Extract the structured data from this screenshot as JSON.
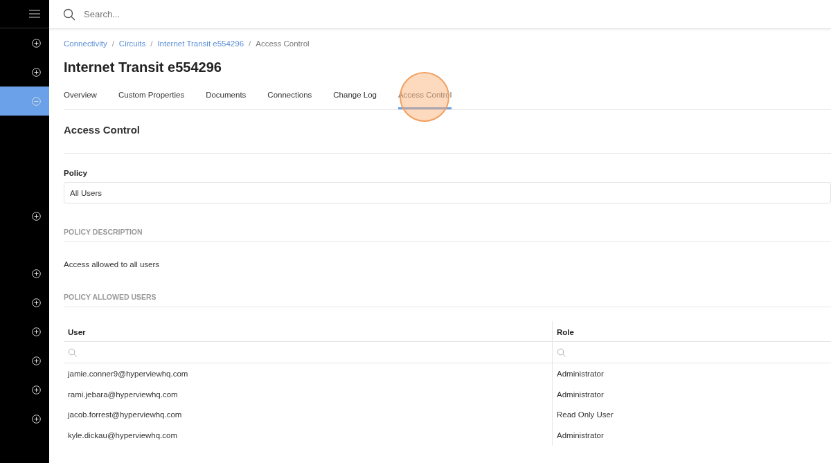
{
  "sidebar": {
    "groups": [
      {
        "items": [
          {
            "expanded": false,
            "selected": false
          },
          {
            "expanded": false,
            "selected": false
          },
          {
            "expanded": true,
            "selected": true
          }
        ]
      },
      {
        "items": [
          {
            "expanded": false,
            "selected": false
          }
        ]
      },
      {
        "items": [
          {
            "expanded": false,
            "selected": false
          },
          {
            "expanded": false,
            "selected": false
          },
          {
            "expanded": false,
            "selected": false
          },
          {
            "expanded": false,
            "selected": false
          },
          {
            "expanded": false,
            "selected": false
          },
          {
            "expanded": false,
            "selected": false
          }
        ]
      }
    ]
  },
  "search": {
    "placeholder": "Search..."
  },
  "breadcrumbs": [
    {
      "label": "Connectivity",
      "link": true
    },
    {
      "label": "Circuits",
      "link": true
    },
    {
      "label": "Internet Transit e554296",
      "link": true
    },
    {
      "label": "Access Control",
      "link": false
    }
  ],
  "breadcrumb_separator": "/",
  "title": "Internet Transit e554296",
  "tabs": [
    {
      "label": "Overview",
      "selected": false,
      "highlighted": false
    },
    {
      "label": "Custom Properties",
      "selected": false,
      "highlighted": false
    },
    {
      "label": "Documents",
      "selected": false,
      "highlighted": false
    },
    {
      "label": "Connections",
      "selected": false,
      "highlighted": false
    },
    {
      "label": "Change Log",
      "selected": false,
      "highlighted": false
    },
    {
      "label": "Access Control",
      "selected": true,
      "highlighted": true
    }
  ],
  "section_title": "Access Control",
  "policy": {
    "label": "Policy",
    "value": "All Users"
  },
  "description": {
    "heading": "POLICY DESCRIPTION",
    "text": "Access allowed to all users"
  },
  "allowed_users": {
    "heading": "POLICY ALLOWED USERS",
    "table": {
      "columns": [
        "User",
        "Role"
      ],
      "rows": [
        [
          "jamie.conner9@hyperviewhq.com",
          "Administrator"
        ],
        [
          "rami.jebara@hyperviewhq.com",
          "Administrator"
        ],
        [
          "jacob.forrest@hyperviewhq.com",
          "Read Only User"
        ],
        [
          "kyle.dickau@hyperviewhq.com",
          "Administrator"
        ]
      ]
    }
  }
}
